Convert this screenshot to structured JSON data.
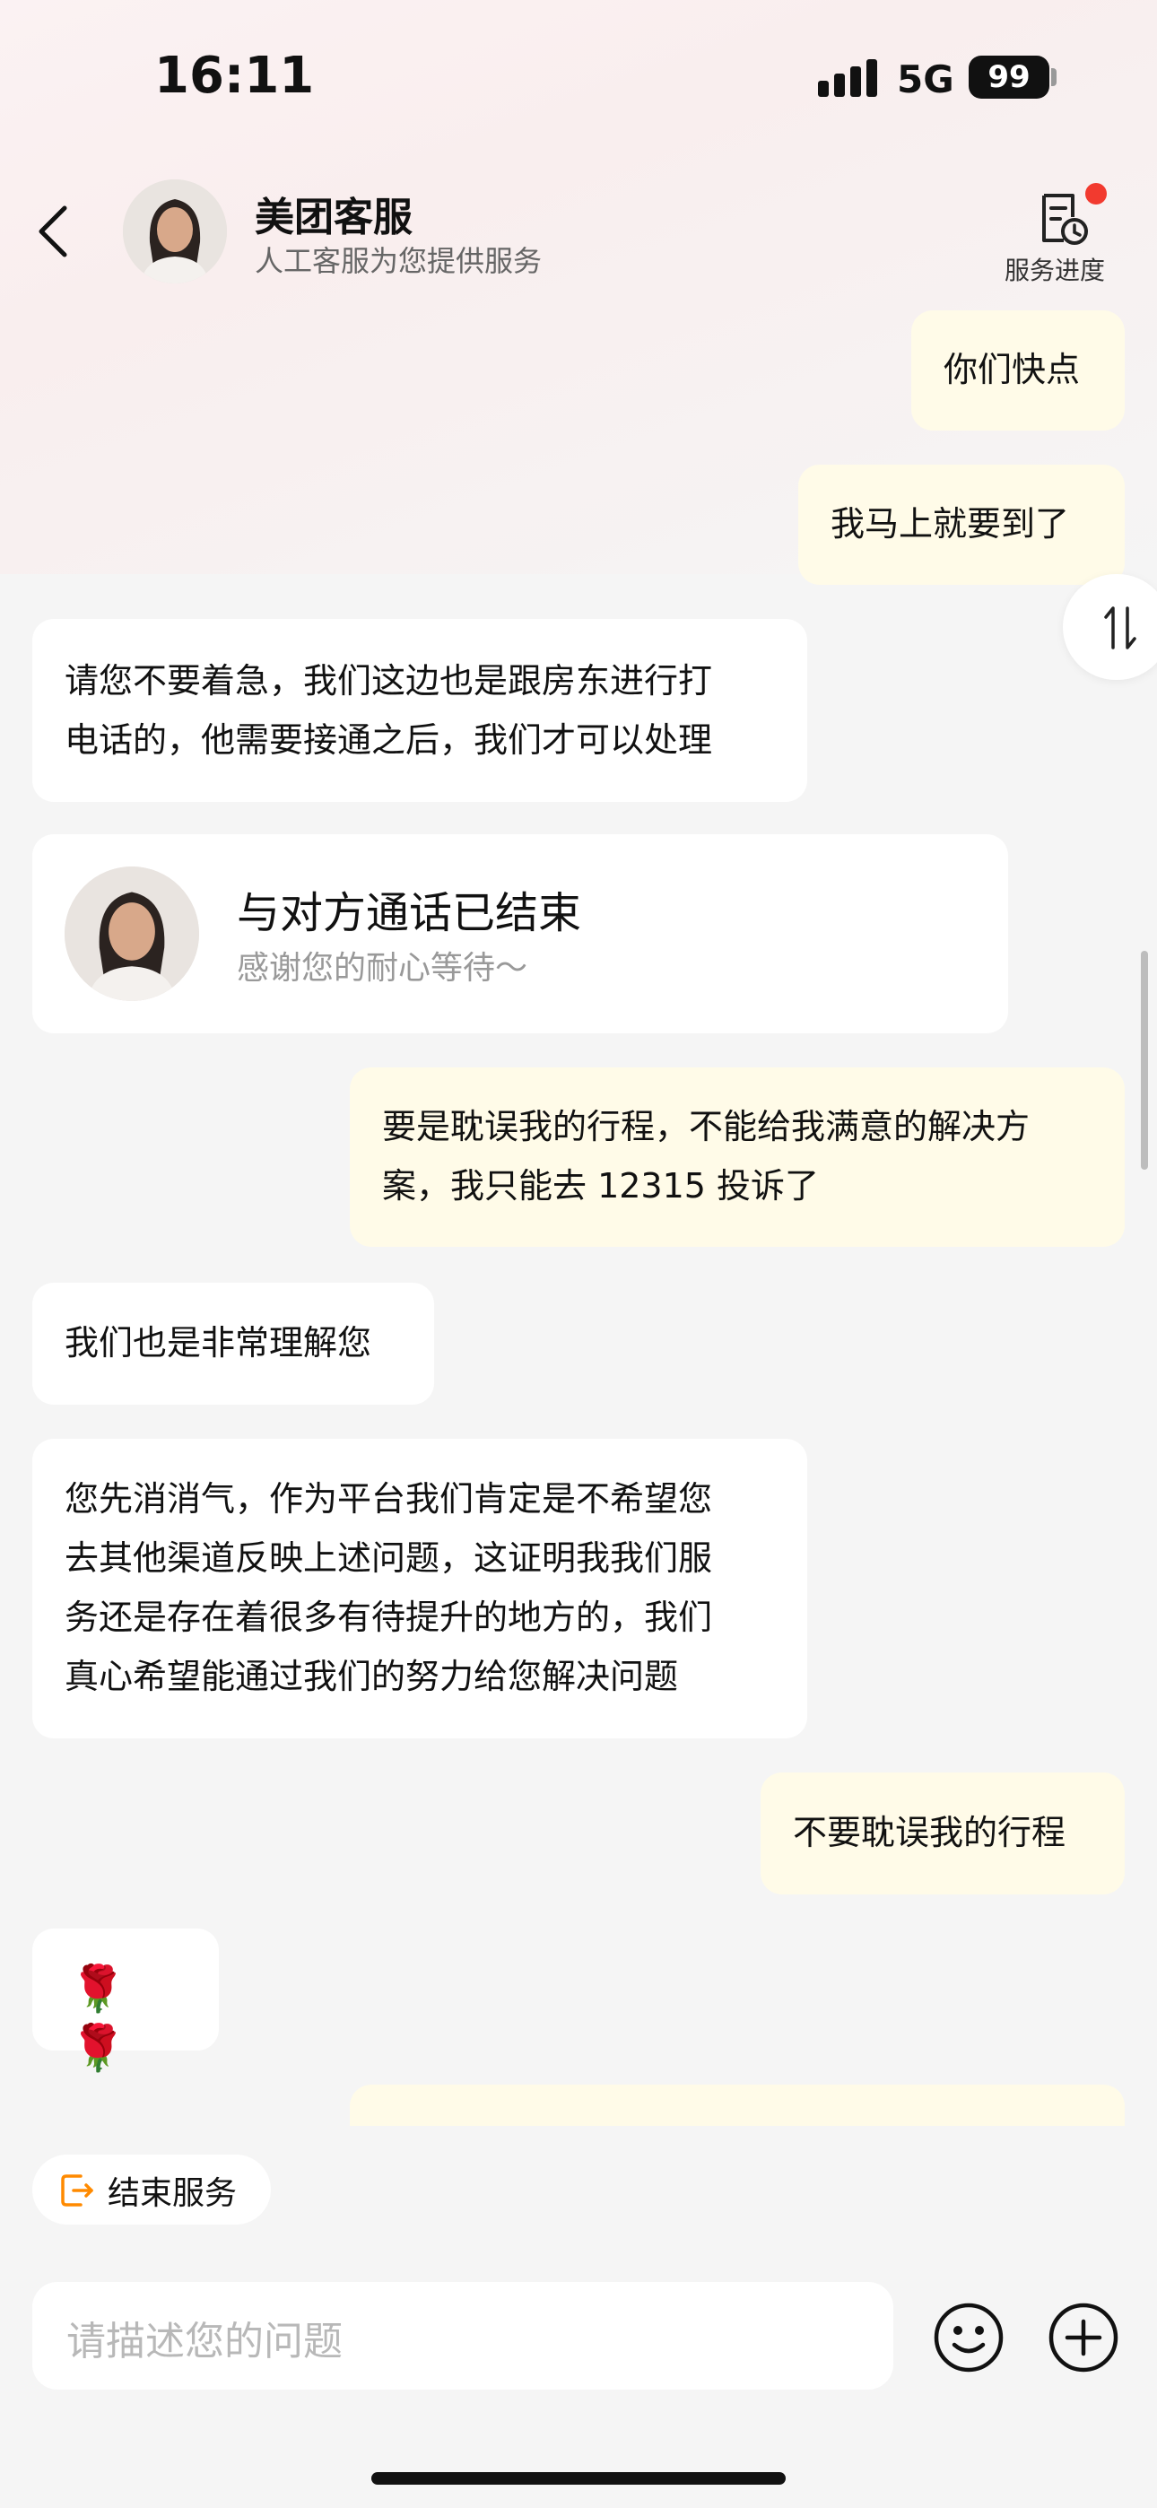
{
  "status_bar": {
    "time": "16:11",
    "network": "5G",
    "battery": "99"
  },
  "header": {
    "title": "美团客服",
    "subtitle": "人工客服为您提供服务",
    "progress_label": "服务进度"
  },
  "messages": [
    {
      "side": "right",
      "text": "你们快点"
    },
    {
      "side": "right",
      "text": "我马上就要到了"
    },
    {
      "side": "left",
      "lines": [
        "请您不要着急，我们这边也是跟房东进行打",
        "电话的，他需要接通之后，我们才可以处理"
      ]
    },
    {
      "side": "right",
      "lines": [
        "要是耽误我的行程，不能给我满意的解决方",
        "案，我只能去 12315 投诉了"
      ]
    },
    {
      "side": "left",
      "text": "我们也是非常理解您"
    },
    {
      "side": "left",
      "lines": [
        "您先消消气，作为平台我们肯定是不希望您",
        "去其他渠道反映上述问题，这证明我我们服",
        "务还是存在着很多有待提升的地方的，我们",
        "真心希望能通过我们的努力给您解决问题"
      ]
    },
    {
      "side": "right",
      "text": "不要耽误我的行程"
    },
    {
      "side": "left",
      "text": "🌹🌹"
    }
  ],
  "call_card": {
    "title": "与对方通话已结束",
    "subtitle": "感谢您的耐心等待～"
  },
  "end_service": {
    "label": "结束服务"
  },
  "input": {
    "placeholder": "请描述您的问题"
  },
  "colors": {
    "right_bubble": "#fffbe8",
    "left_bubble": "#ffffff",
    "accent_orange": "#ff8a00",
    "notification_red": "#f23a2f"
  }
}
